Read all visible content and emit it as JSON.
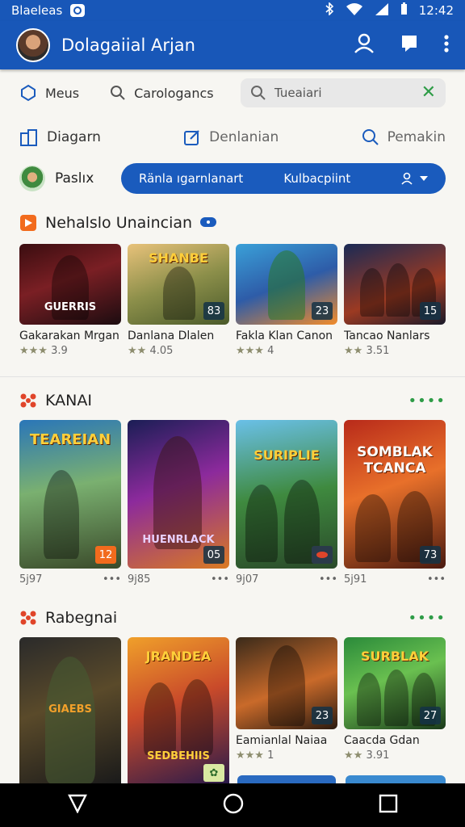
{
  "status": {
    "left_text": "Blaeleas",
    "time": "12:42"
  },
  "app": {
    "title": "Dolagaiial Arjan"
  },
  "toolbar": {
    "item1": "Meus",
    "item2": "Carologancs",
    "search_value": "Tueaiari"
  },
  "tabs": {
    "tab1": "Diagarn",
    "tab2": "Denlanian",
    "tab3": "Pemakin"
  },
  "user": {
    "name": "Paslıx",
    "pill_left": "Ränla ıgarnlanart",
    "pill_mid": "Kulbacpiint"
  },
  "sections": {
    "s1": {
      "title": "Nehalslo Unaincian",
      "icon": "play-icon",
      "accent": "#f26b1d"
    },
    "s2": {
      "title": "KANAI",
      "icon": "dice-icon",
      "accent": "#e0452a"
    },
    "s3": {
      "title": "Rabegnai",
      "icon": "dice-icon",
      "accent": "#e0452a"
    }
  },
  "row1": [
    {
      "title": "Gakarakan Mrgan",
      "rating": "★★★ 3.9",
      "badge": "",
      "cap": "",
      "bcap": "GUERRIS"
    },
    {
      "title": "Danlana Dlalen",
      "rating": "★★ 4.05",
      "badge": "83",
      "cap": "SHANBE",
      "bcap": ""
    },
    {
      "title": "Fakla Klan Canon",
      "rating": "★★★ 4",
      "badge": "23",
      "cap": "",
      "bcap": ""
    },
    {
      "title": "Tancao Nanlars",
      "rating": "★★ 3.51",
      "badge": "15",
      "cap": "",
      "bcap": ""
    }
  ],
  "row2": [
    {
      "meta_left": "5j97",
      "badge": "12",
      "cap": "TEAREIAN",
      "bcap": ""
    },
    {
      "meta_left": "9j85",
      "badge": "05",
      "cap": "",
      "bcap": "HUENRLACK"
    },
    {
      "meta_left": "9j07",
      "badge": "",
      "cap": "SURIPLIE",
      "bcap": ""
    },
    {
      "meta_left": "5j91",
      "badge": "73",
      "cap": "SOMBLAK TCANCA",
      "bcap": ""
    }
  ],
  "row3": [
    {
      "title": "",
      "rating": "",
      "badge": "",
      "cap": "",
      "bcap": "GIAEBS"
    },
    {
      "title": "",
      "rating": "",
      "badge": "",
      "cap": "JRANDEA",
      "bcap": "SEDBEHIIS"
    },
    {
      "title": "Eamianlal Naiaa",
      "rating": "★★★ 1",
      "badge": "23",
      "cap": "",
      "bcap": ""
    },
    {
      "title": "Caacda Gdan",
      "rating": "★★ 3.91",
      "badge": "27",
      "cap": "SURBLAK",
      "bcap": ""
    }
  ],
  "colors": {
    "brand": "#1857b8",
    "accent_green": "#2e9c47"
  }
}
